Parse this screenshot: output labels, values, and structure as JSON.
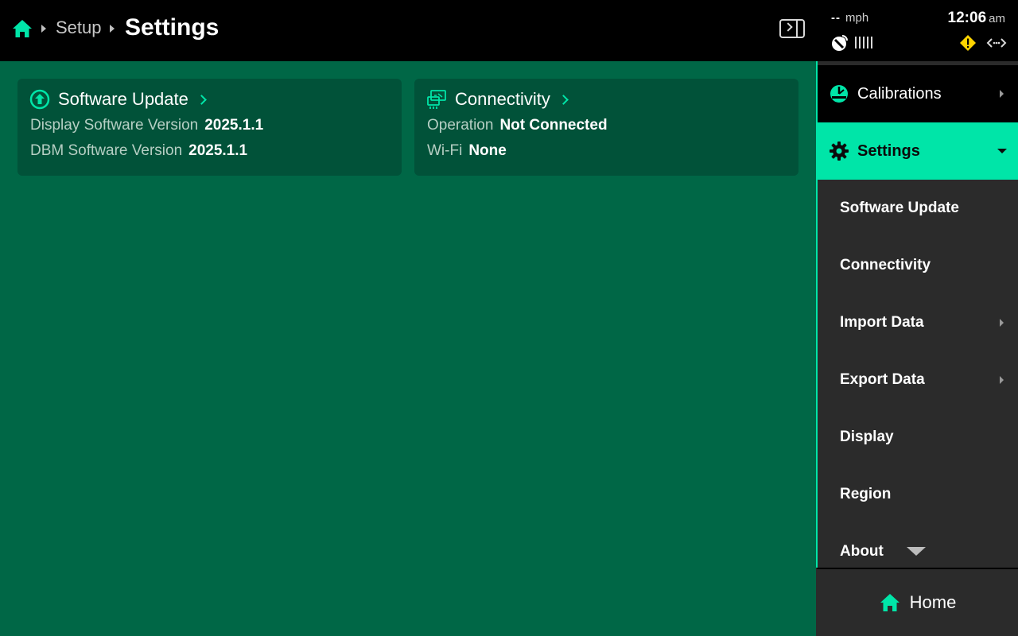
{
  "header": {
    "breadcrumb_parent": "Setup",
    "title": "Settings"
  },
  "status": {
    "speed_value": "--",
    "speed_unit": "mph",
    "time": "12:06",
    "ampm": "am"
  },
  "cards": {
    "software_update": {
      "title": "Software Update",
      "rows": [
        {
          "label": "Display Software Version",
          "value": "2025.1.1"
        },
        {
          "label": "DBM Software Version",
          "value": "2025.1.1"
        }
      ]
    },
    "connectivity": {
      "title": "Connectivity",
      "rows": [
        {
          "label": "Operation",
          "value": "Not Connected"
        },
        {
          "label": "Wi-Fi",
          "value": "None"
        }
      ]
    }
  },
  "menu": {
    "calibrations_label": "Calibrations",
    "settings_label": "Settings",
    "sub_items": [
      {
        "label": "Software Update",
        "has_arrow": false
      },
      {
        "label": "Connectivity",
        "has_arrow": false
      },
      {
        "label": "Import Data",
        "has_arrow": true
      },
      {
        "label": "Export Data",
        "has_arrow": true
      },
      {
        "label": "Display",
        "has_arrow": false
      },
      {
        "label": "Region",
        "has_arrow": false
      },
      {
        "label": "About",
        "has_arrow": false
      }
    ],
    "home_label": "Home"
  },
  "colors": {
    "accent": "#00e5a8",
    "main_bg": "#006746",
    "card_bg": "#015239",
    "menu_bg": "#2b2b2b",
    "warning": "#ffd400"
  },
  "icons": {
    "home": "home-icon",
    "panel_toggle": "panel-toggle-icon",
    "satellite": "satellite-icon",
    "warning": "warning-icon",
    "link": "link-icon",
    "software_update": "upload-circle-icon",
    "connectivity": "connectivity-icon",
    "calibrations": "gauge-icon",
    "settings": "gear-icon"
  }
}
